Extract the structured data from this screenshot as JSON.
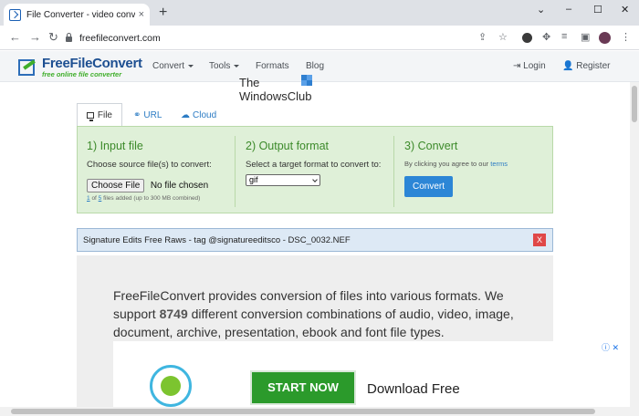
{
  "browser": {
    "tab_title": "File Converter - video converter,",
    "tab_close": "×",
    "new_tab": "+",
    "win_minimize": "–",
    "win_maximize": "☐",
    "win_close": "✕",
    "url": "freefileconvert.com"
  },
  "site": {
    "logo_main": "FreeFileConvert",
    "logo_sub": "free online file converter",
    "nav": [
      {
        "label": "Convert",
        "has_dropdown": true
      },
      {
        "label": "Tools",
        "has_dropdown": true
      },
      {
        "label": "Formats",
        "has_dropdown": false
      },
      {
        "label": "Blog",
        "has_dropdown": false
      }
    ],
    "login": "Login",
    "register": "Register"
  },
  "watermark": {
    "line1": "The",
    "line2": "WindowsClub"
  },
  "converter": {
    "tabs": [
      {
        "label": "File",
        "active": true
      },
      {
        "label": "URL",
        "active": false
      },
      {
        "label": "Cloud",
        "active": false
      }
    ],
    "input": {
      "heading": "1) Input file",
      "label": "Choose source file(s) to convert:",
      "choose_button": "Choose File",
      "no_file": "No file chosen",
      "count_current": "1",
      "count_of": "of",
      "count_max": "5",
      "count_note": "files added (up to 300 MB combined)"
    },
    "output": {
      "heading": "2) Output format",
      "label": "Select a target format to convert to:",
      "selected_format": "gif"
    },
    "convert": {
      "heading": "3) Convert",
      "agree_text": "By clicking you agree to our",
      "terms_link": "terms",
      "button": "Convert"
    }
  },
  "file_row": {
    "name": "Signature Edits Free Raws - tag @signatureeditsco - DSC_0032.NEF",
    "remove": "X"
  },
  "info": {
    "text_before": "FreeFileConvert provides conversion of files into various formats. We support",
    "count": "8749",
    "text_after": "different conversion combinations of audio, video, image, document, archive, presentation, ebook and font file types."
  },
  "ad": {
    "button": "START NOW",
    "text": "Download Free"
  },
  "colors": {
    "panel_bg": "#dff0d8",
    "heading_green": "#3c8a2a",
    "link_blue": "#2c7cc4",
    "convert_button": "#2c86d6",
    "remove_red": "#e04848"
  }
}
